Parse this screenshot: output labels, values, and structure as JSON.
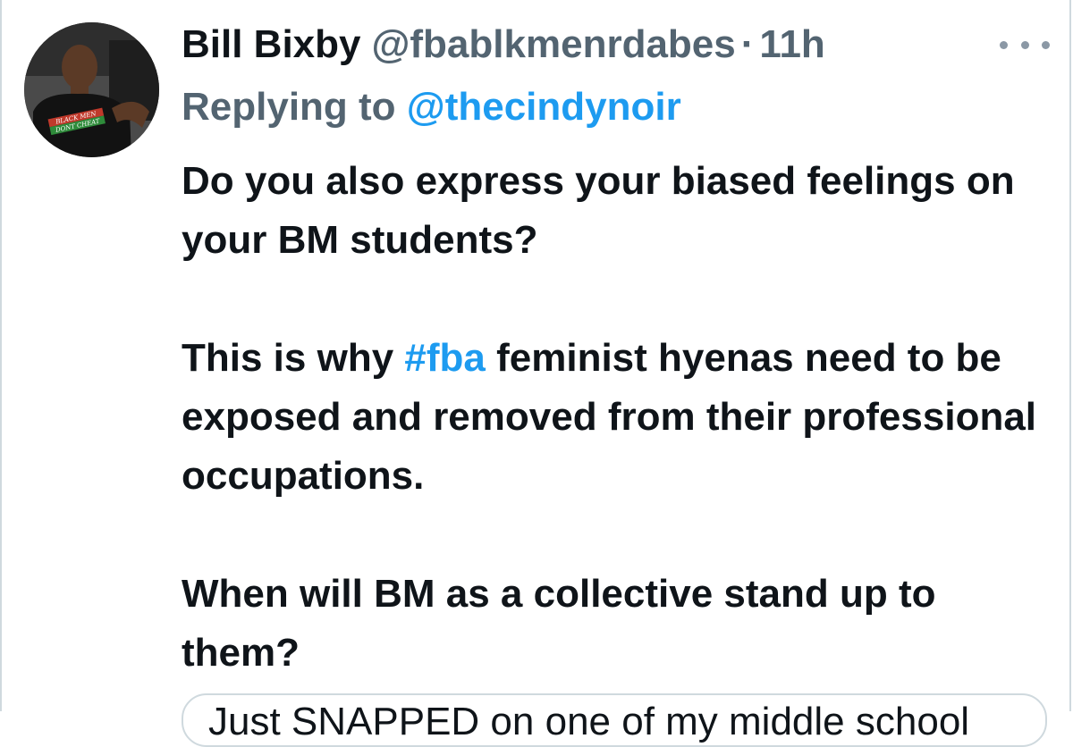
{
  "tweet": {
    "author_name": "Bill Bixby",
    "author_handle": "@fbablkmenrdabes",
    "separator": "·",
    "timestamp": "11h",
    "more_icon": "more-horizontal-icon",
    "reply_prefix": "Replying to",
    "reply_to": "@thecindynoir",
    "avatar_shirt_text": [
      "BLACK MEN",
      "DONT CHEAT"
    ],
    "body": {
      "line1": "Do you also express your biased feelings on your BM students?",
      "p2_before": "This is why ",
      "p2_hashtag": "#fba",
      "p2_after": " feminist hyenas need to be exposed and removed from their professional occupations.",
      "p3": "When will BM as a collective stand up to them?"
    },
    "quote_preview": "Just SNAPPED on one of my middle school"
  },
  "colors": {
    "text_primary": "#0f1419",
    "text_secondary": "#536471",
    "link": "#1d9bf0",
    "border": "#cfd9de"
  }
}
